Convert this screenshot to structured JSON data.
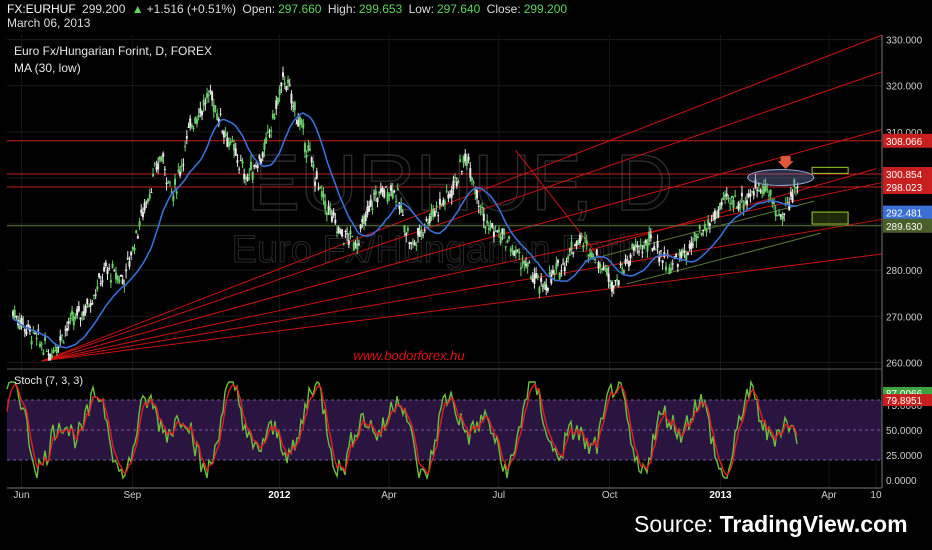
{
  "header": {
    "symbol": "FX:EURHUF",
    "last": "299.200",
    "change": "+1.516 (+0.51%)",
    "open_label": "Open:",
    "open": "297.660",
    "high_label": "High:",
    "high": "299.653",
    "low_label": "Low:",
    "low": "297.640",
    "close_label": "Close:",
    "close": "299.200",
    "date": "March 06, 2013"
  },
  "chart_title": "Euro Fx/Hungarian Forint, D, FOREX",
  "ma_label": "MA (30, low)",
  "stoch_label": "Stoch (7, 3, 3)",
  "watermark": {
    "line1": "EURHUF, D",
    "line2": "Euro Fx/Hungarian Forint"
  },
  "site": "www.bodorforex.hu",
  "source": {
    "prefix": "Source: ",
    "brand": "TradingView.com"
  },
  "colors": {
    "bg": "#000000",
    "up": "#6ccf6c",
    "down": "#e8e8e8",
    "ma": "#3b6fd6",
    "trend": "#cc1111",
    "level": "#c71e1e",
    "support": "#5a7a3a",
    "stoch_k": "#6fbf3f",
    "stoch_d": "#dd2222",
    "stoch_band": "#2a1440"
  },
  "chart_data": {
    "type": "candlestick",
    "title": "Euro Fx/Hungarian Forint, D, FOREX",
    "x_ticks": [
      "Jun",
      "Sep",
      "2012",
      "Apr",
      "Jul",
      "Oct",
      "2013",
      "Apr",
      "10"
    ],
    "y_ticks": [
      260,
      270,
      280,
      290,
      300,
      310,
      320,
      330
    ],
    "ylim": [
      259,
      331
    ],
    "price_labels": [
      {
        "text": "308.066",
        "value": 308.066,
        "color": "#c71e1e"
      },
      {
        "text": "300.854",
        "value": 300.854,
        "color": "#c71e1e"
      },
      {
        "text": "298.023",
        "value": 298.023,
        "color": "#c71e1e"
      },
      {
        "text": "292.481",
        "value": 292.481,
        "color": "#3b6fd6"
      },
      {
        "text": "289.630",
        "value": 289.63,
        "color": "#4a5f2a"
      }
    ],
    "horizontal_levels": [
      308.066,
      300.854,
      298.023,
      289.63
    ],
    "price_path": [
      [
        "2011-05-25",
        271
      ],
      [
        "2011-06-10",
        266
      ],
      [
        "2011-06-25",
        262
      ],
      [
        "2011-07-10",
        268
      ],
      [
        "2011-07-25",
        272
      ],
      [
        "2011-08-10",
        280
      ],
      [
        "2011-08-25",
        278
      ],
      [
        "2011-09-10",
        293
      ],
      [
        "2011-09-25",
        305
      ],
      [
        "2011-10-05",
        296
      ],
      [
        "2011-10-20",
        312
      ],
      [
        "2011-11-05",
        318
      ],
      [
        "2011-11-20",
        308
      ],
      [
        "2011-12-05",
        300
      ],
      [
        "2011-12-20",
        306
      ],
      [
        "2012-01-05",
        322
      ],
      [
        "2012-01-20",
        310
      ],
      [
        "2012-02-05",
        296
      ],
      [
        "2012-02-20",
        288
      ],
      [
        "2012-03-05",
        286
      ],
      [
        "2012-03-20",
        296
      ],
      [
        "2012-04-05",
        298
      ],
      [
        "2012-04-20",
        285
      ],
      [
        "2012-05-05",
        292
      ],
      [
        "2012-05-20",
        296
      ],
      [
        "2012-06-05",
        305
      ],
      [
        "2012-06-20",
        290
      ],
      [
        "2012-07-05",
        287
      ],
      [
        "2012-07-20",
        282
      ],
      [
        "2012-08-05",
        276
      ],
      [
        "2012-08-20",
        280
      ],
      [
        "2012-09-05",
        287
      ],
      [
        "2012-09-20",
        283
      ],
      [
        "2012-10-05",
        277
      ],
      [
        "2012-10-20",
        284
      ],
      [
        "2012-11-05",
        286
      ],
      [
        "2012-11-20",
        281
      ],
      [
        "2012-12-05",
        284
      ],
      [
        "2012-12-20",
        289
      ],
      [
        "2013-01-05",
        295
      ],
      [
        "2013-01-20",
        295
      ],
      [
        "2013-02-05",
        299
      ],
      [
        "2013-02-20",
        291
      ],
      [
        "2013-03-06",
        299.2
      ]
    ],
    "stoch": {
      "name": "Stoch (7, 3, 3)",
      "ylim": [
        -5,
        105
      ],
      "y_ticks": [
        0,
        25,
        50,
        75
      ],
      "y_tick_labels": [
        "0.0000",
        "25.0000",
        "50.0000",
        "75.0000"
      ],
      "band": [
        20,
        80
      ],
      "last_k": "87.0066",
      "last_d": "79.8951"
    }
  }
}
